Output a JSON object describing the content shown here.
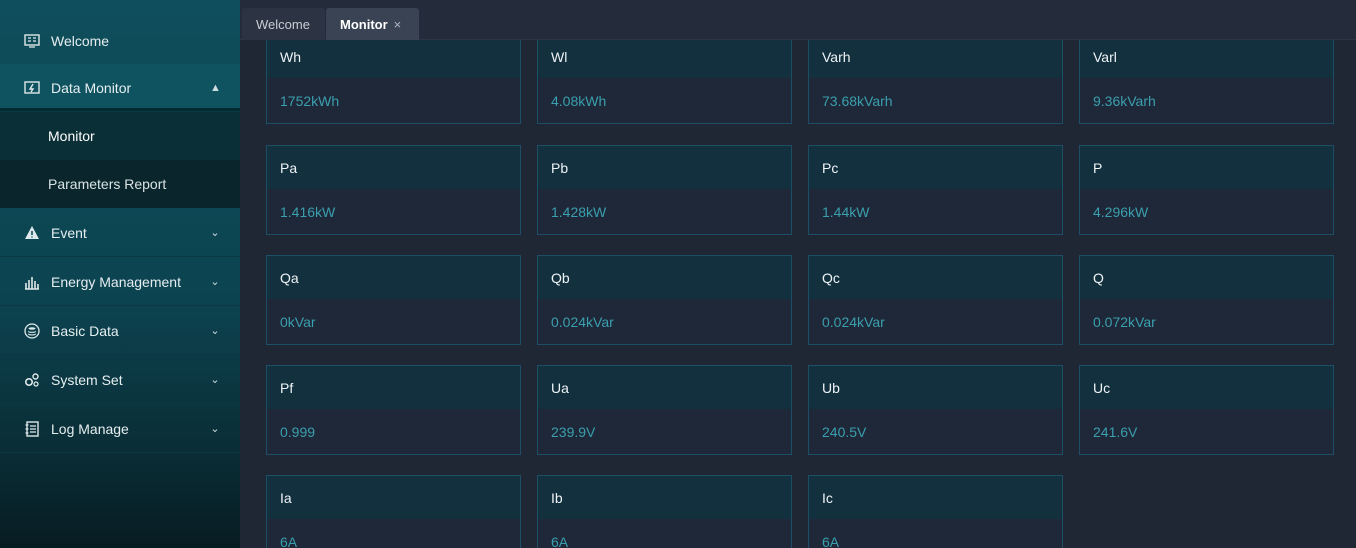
{
  "sidebar": {
    "items": [
      {
        "label": "Welcome",
        "icon": "welcome-icon"
      },
      {
        "label": "Data Monitor",
        "icon": "data-monitor-icon",
        "expanded": true
      },
      {
        "label": "Event",
        "icon": "warning-icon"
      },
      {
        "label": "Energy Management",
        "icon": "bar-chart-icon"
      },
      {
        "label": "Basic Data",
        "icon": "database-icon"
      },
      {
        "label": "System Set",
        "icon": "gears-icon"
      },
      {
        "label": "Log Manage",
        "icon": "log-icon"
      }
    ],
    "sub_items": [
      {
        "label": "Monitor",
        "selected": true
      },
      {
        "label": "Parameters Report"
      }
    ]
  },
  "tabs": [
    {
      "label": "Welcome"
    },
    {
      "label": "Monitor",
      "close": "×"
    }
  ],
  "cards": [
    {
      "name": "Wh",
      "value": "1752kWh"
    },
    {
      "name": "Wl",
      "value": "4.08kWh"
    },
    {
      "name": "Varh",
      "value": "73.68kVarh"
    },
    {
      "name": "Varl",
      "value": "9.36kVarh"
    },
    {
      "name": "Pa",
      "value": "1.416kW"
    },
    {
      "name": "Pb",
      "value": "1.428kW"
    },
    {
      "name": "Pc",
      "value": "1.44kW"
    },
    {
      "name": "P",
      "value": "4.296kW"
    },
    {
      "name": "Qa",
      "value": "0kVar"
    },
    {
      "name": "Qb",
      "value": "0.024kVar"
    },
    {
      "name": "Qc",
      "value": "0.024kVar"
    },
    {
      "name": "Q",
      "value": "0.072kVar"
    },
    {
      "name": "Pf",
      "value": "0.999"
    },
    {
      "name": "Ua",
      "value": "239.9V"
    },
    {
      "name": "Ub",
      "value": "240.5V"
    },
    {
      "name": "Uc",
      "value": "241.6V"
    },
    {
      "name": "Ia",
      "value": "6A"
    },
    {
      "name": "Ib",
      "value": "6A"
    },
    {
      "name": "Ic",
      "value": "6A"
    }
  ],
  "colors": {
    "accent": "#3a9fae",
    "sidebar": "#0f4e5c",
    "card_border": "#1c4f66"
  }
}
